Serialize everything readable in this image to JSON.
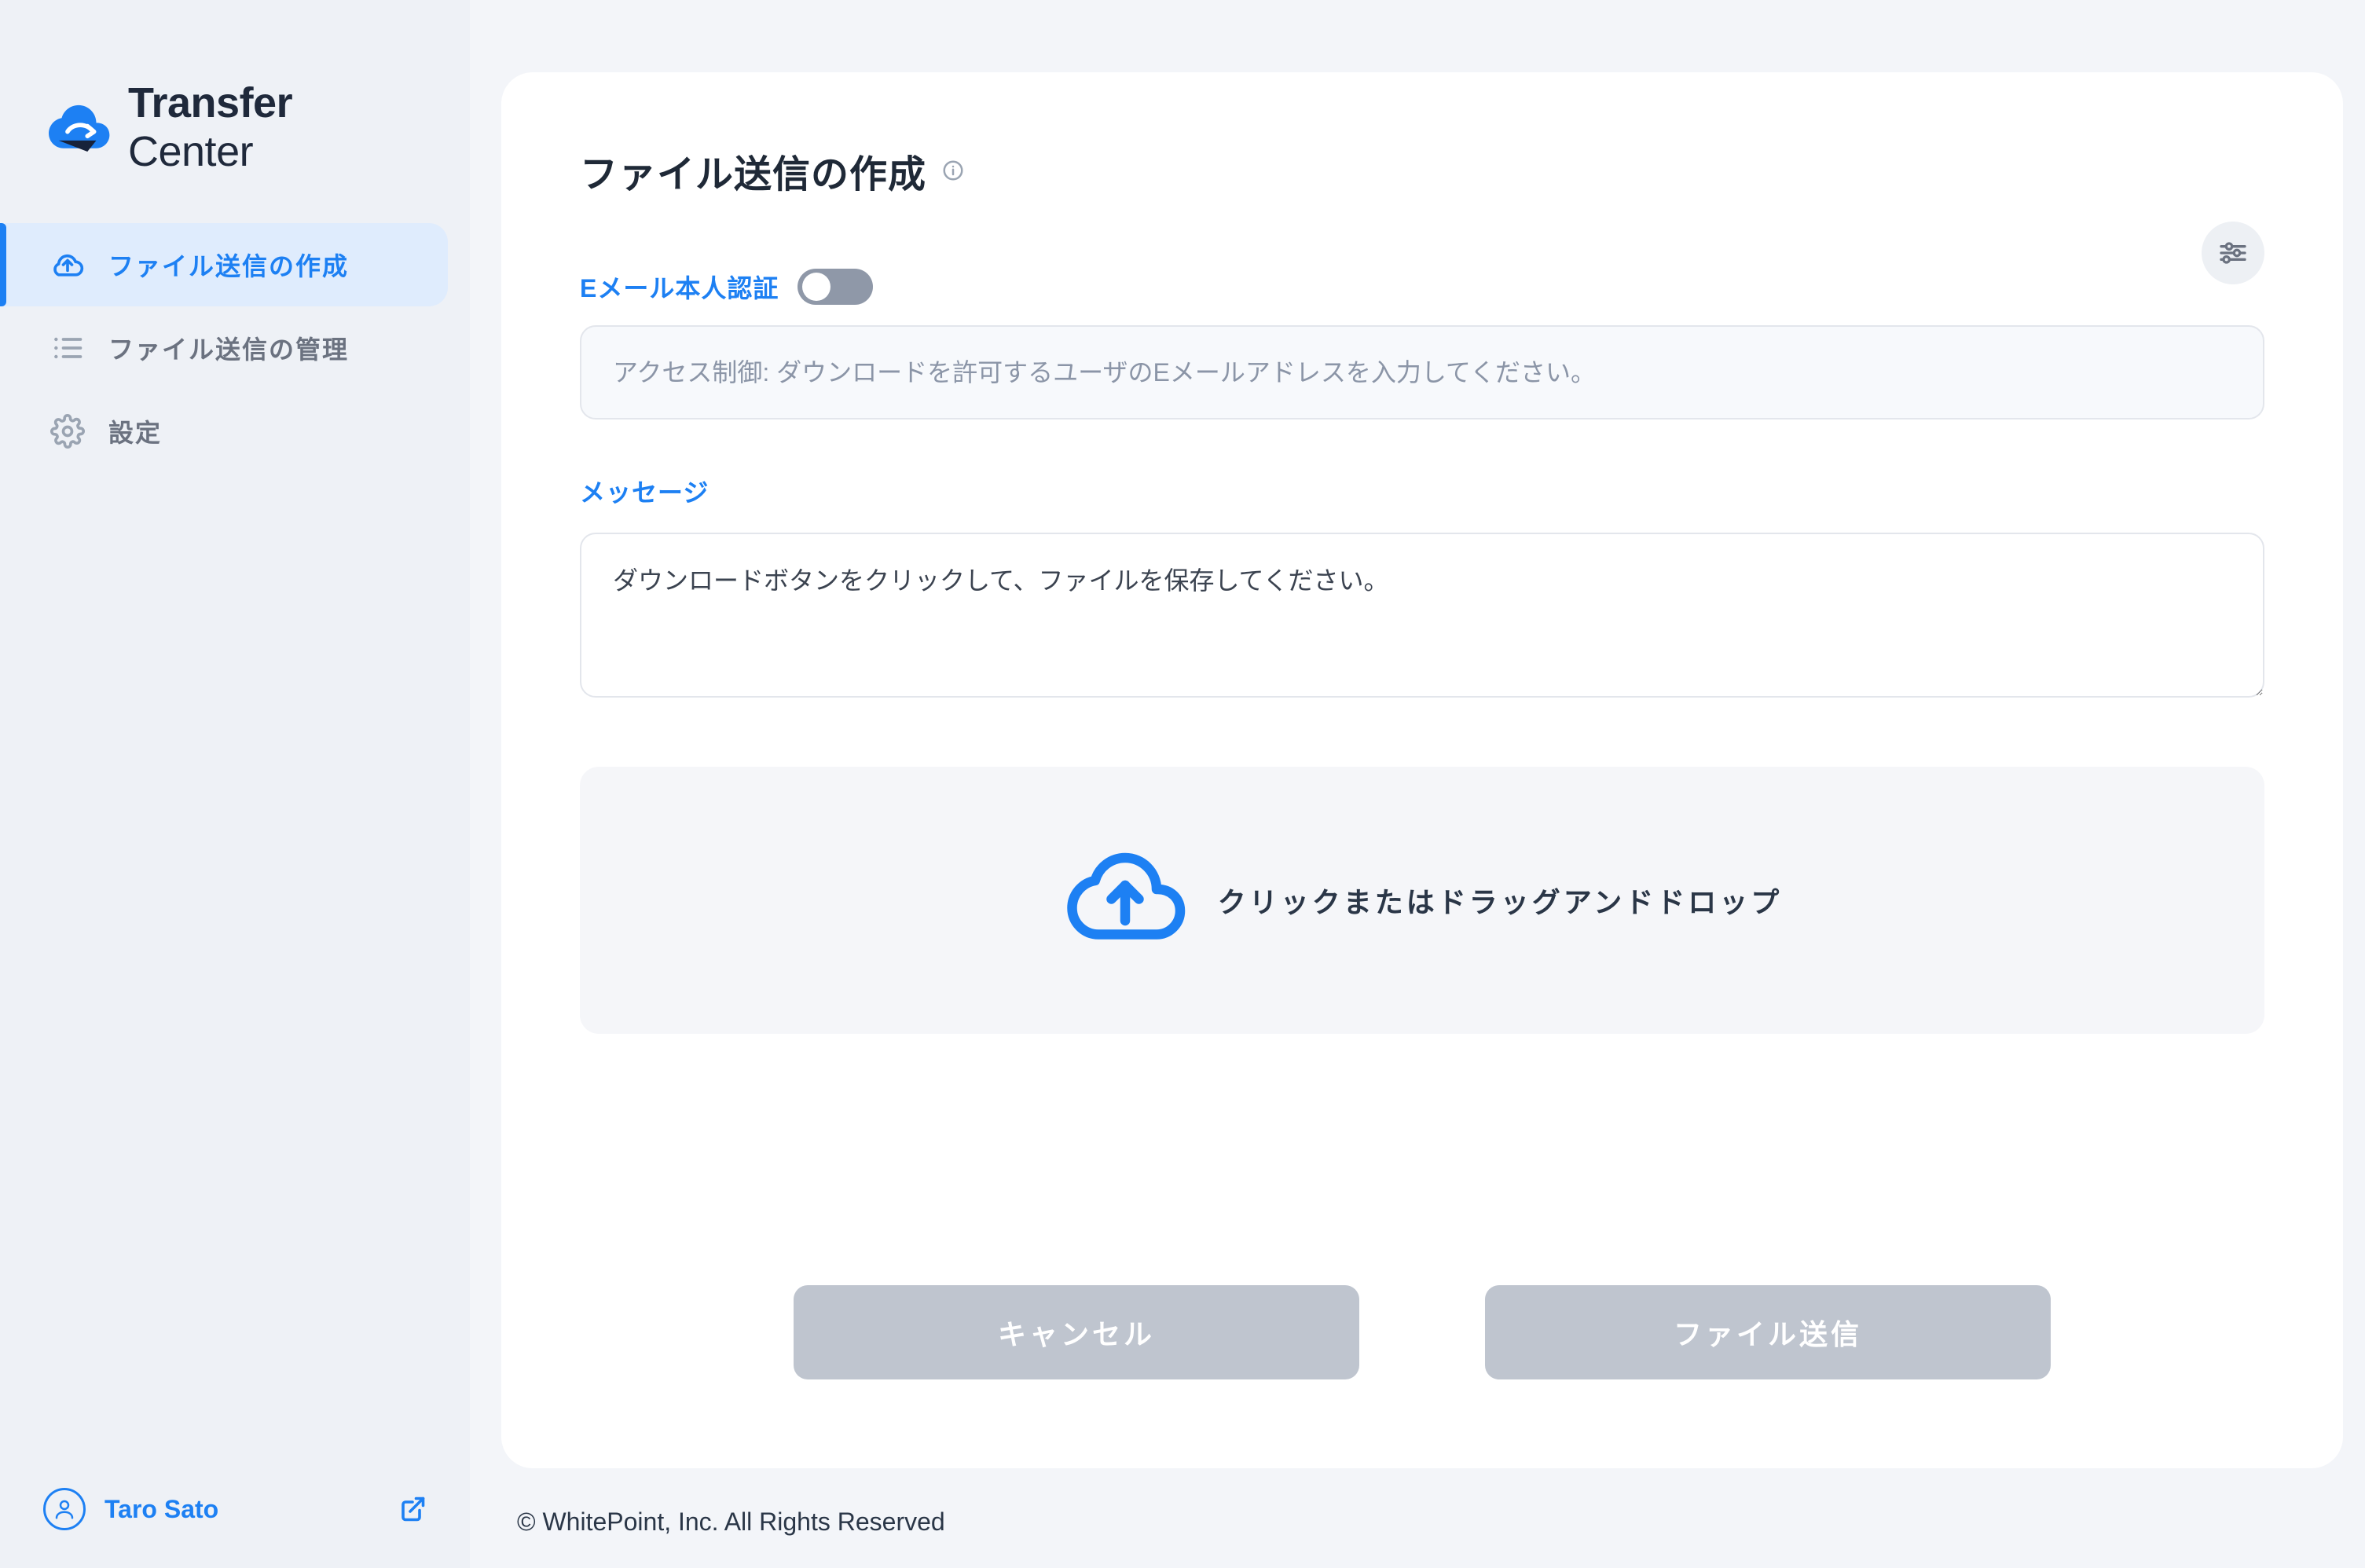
{
  "brand": {
    "bold": "Transfer",
    "light": " Center"
  },
  "sidebar": {
    "items": [
      {
        "label": "ファイル送信の作成"
      },
      {
        "label": "ファイル送信の管理"
      },
      {
        "label": "設定"
      }
    ],
    "user": {
      "name": "Taro Sato"
    }
  },
  "main": {
    "title": "ファイル送信の作成",
    "email_verify_label": "Eメール本人認証",
    "access_placeholder": "アクセス制御: ダウンロードを許可するユーザのEメールアドレスを入力してください。",
    "message_label": "メッセージ",
    "message_value": "ダウンロードボタンをクリックして、ファイルを保存してください。",
    "dropzone_text": "クリックまたはドラッグアンドドロップ",
    "cancel_label": "キャンセル",
    "submit_label": "ファイル送信"
  },
  "footer": {
    "copyright": "© WhitePoint, Inc. All Rights Reserved"
  },
  "colors": {
    "accent": "#1d80f3"
  }
}
